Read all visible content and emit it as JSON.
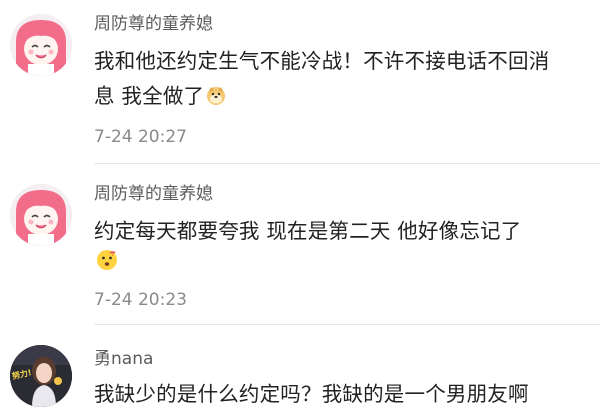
{
  "comments": [
    {
      "author": "周防尊的童养媳",
      "text": "我和他还约定生气不能冷战！不许不接电话不回消息  我全做了",
      "emoji": "doge-emoji",
      "time": "7-24 20:27"
    },
    {
      "author": "周防尊的童养媳",
      "text": "约定每天都要夸我  现在是第二天  他好像忘记了",
      "emoji": "confused-emoji",
      "time": "7-24 20:23"
    },
    {
      "author": "勇nana",
      "text": "我缺少的是什么约定吗？我缺的是一个男朋友啊",
      "avatar_badge": "努力!"
    }
  ]
}
